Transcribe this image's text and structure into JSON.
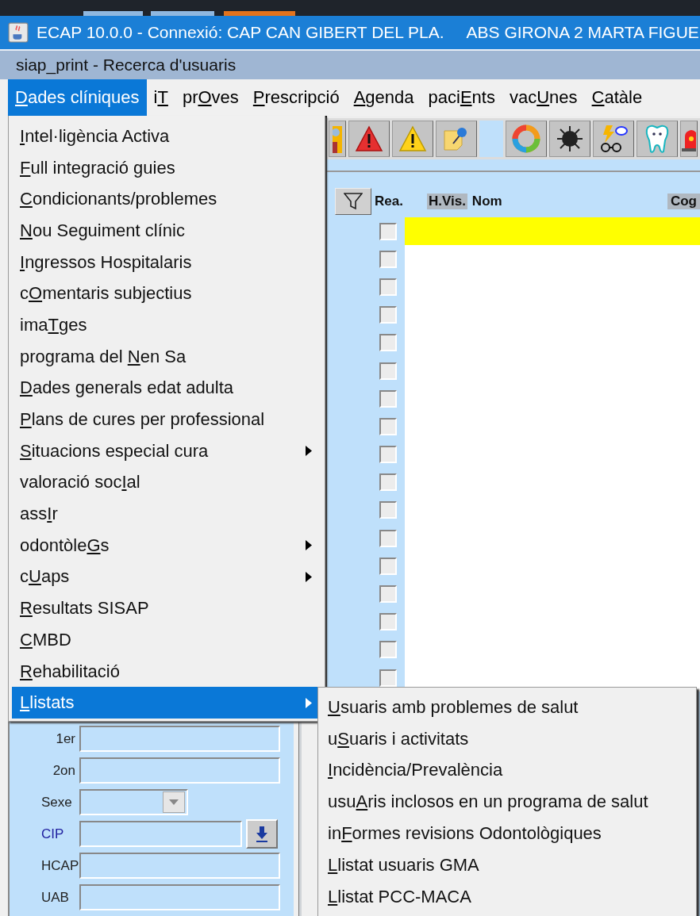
{
  "window": {
    "title": "ECAP 10.0.0 - Connexió: CAP CAN GIBERT DEL PLA.",
    "title_extra": "ABS GIRONA 2 MARTA FIGUE"
  },
  "subwindow": {
    "title": "siap_print - Recerca d'usuaris"
  },
  "menubar": [
    {
      "key": "D",
      "after": "ades clíniques",
      "selected": true
    },
    {
      "before": "i",
      "key": "T",
      "selected": false
    },
    {
      "before": "pr",
      "key": "O",
      "after": "ves",
      "selected": false
    },
    {
      "key": "P",
      "after": "rescripció",
      "selected": false
    },
    {
      "key": "A",
      "after": "genda",
      "selected": false
    },
    {
      "before": "paci",
      "key": "E",
      "after": "nts",
      "selected": false
    },
    {
      "before": "vac",
      "key": "U",
      "after": "nes",
      "selected": false
    },
    {
      "key": "C",
      "after": "atàle",
      "selected": false
    }
  ],
  "menu": [
    {
      "key": "I",
      "after": "ntel·ligència Activa",
      "submenu": false,
      "selected": false
    },
    {
      "key": "F",
      "after": "ull integració guies",
      "submenu": false,
      "selected": false
    },
    {
      "key": "C",
      "after": "ondicionants/problemes",
      "submenu": false,
      "selected": false
    },
    {
      "key": "N",
      "after": "ou Seguiment clínic",
      "submenu": false,
      "selected": false
    },
    {
      "key": "I",
      "after": "ngressos Hospitalaris",
      "submenu": false,
      "selected": false
    },
    {
      "before": "c",
      "key": "O",
      "after": "mentaris subjectius",
      "submenu": false,
      "selected": false
    },
    {
      "before": "ima",
      "key": "T",
      "after": "ges",
      "submenu": false,
      "selected": false
    },
    {
      "before": "programa del ",
      "key": "N",
      "after": "en Sa",
      "submenu": false,
      "selected": false
    },
    {
      "key": "D",
      "after": "ades generals edat adulta",
      "submenu": false,
      "selected": false
    },
    {
      "key": "P",
      "after": "lans de cures per professional",
      "submenu": false,
      "selected": false
    },
    {
      "key": "S",
      "after": "ituacions especial cura",
      "submenu": true,
      "selected": false
    },
    {
      "before": "valoració soc",
      "key": "I",
      "after": "al",
      "submenu": false,
      "selected": false
    },
    {
      "before": "ass",
      "key": "I",
      "after": "r",
      "submenu": false,
      "selected": false
    },
    {
      "before": "odontòle",
      "key": "G",
      "after": "s",
      "submenu": true,
      "selected": false
    },
    {
      "before": "c",
      "key": "U",
      "after": "aps",
      "submenu": true,
      "selected": false
    },
    {
      "key": "R",
      "after": "esultats SISAP",
      "submenu": false,
      "selected": false
    },
    {
      "key": "C",
      "after": "MBD",
      "submenu": false,
      "selected": false
    },
    {
      "key": "R",
      "after": "ehabilitació",
      "submenu": false,
      "selected": false
    },
    {
      "key": "L",
      "after": "listats",
      "submenu": true,
      "selected": true
    }
  ],
  "submenu": [
    {
      "key": "U",
      "after": "suaris amb problemes de salut"
    },
    {
      "before": "u",
      "key": "S",
      "after": "uaris i activitats"
    },
    {
      "key": "I",
      "after": "ncidència/Prevalència"
    },
    {
      "before": "usu",
      "key": "A",
      "after": "ris inclosos en un programa de salut"
    },
    {
      "before": "in",
      "key": "F",
      "after": "ormes revisions Odontològiques"
    },
    {
      "key": "L",
      "after": "listat usuaris GMA"
    },
    {
      "key": "L",
      "after": "listat PCC-MACA"
    }
  ],
  "table": {
    "columns": [
      "Rea.",
      "H.Vis.",
      "Nom",
      "Cog"
    ],
    "rows": [
      {
        "checked": false,
        "selected": true
      },
      {
        "checked": false,
        "selected": false
      },
      {
        "checked": false,
        "selected": false
      },
      {
        "checked": false,
        "selected": false
      },
      {
        "checked": false,
        "selected": false
      },
      {
        "checked": false,
        "selected": false
      },
      {
        "checked": false,
        "selected": false
      },
      {
        "checked": false,
        "selected": false
      },
      {
        "checked": false,
        "selected": false
      },
      {
        "checked": false,
        "selected": false
      },
      {
        "checked": false,
        "selected": false
      },
      {
        "checked": false,
        "selected": false
      },
      {
        "checked": false,
        "selected": false
      },
      {
        "checked": false,
        "selected": false
      },
      {
        "checked": false,
        "selected": false
      },
      {
        "checked": false,
        "selected": false
      },
      {
        "checked": false,
        "selected": false
      }
    ]
  },
  "form": [
    {
      "label": "1er",
      "kind": "text"
    },
    {
      "label": "2on",
      "kind": "text"
    },
    {
      "label": "Sexe",
      "kind": "combo"
    },
    {
      "label": "CIP",
      "kind": "lookup"
    },
    {
      "label": "HCAP",
      "kind": "text"
    },
    {
      "label": "UAB",
      "kind": "text"
    }
  ]
}
